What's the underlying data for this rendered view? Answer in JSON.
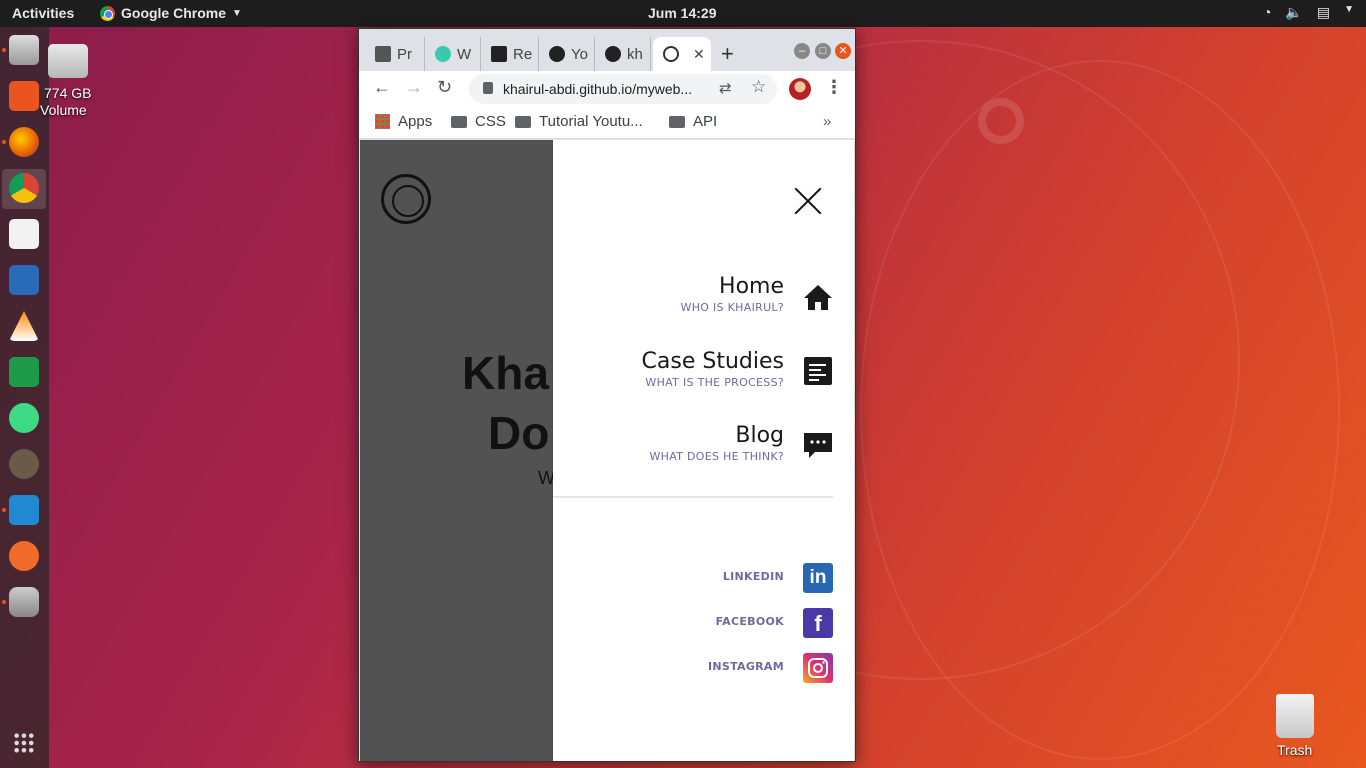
{
  "topbar": {
    "activities": "Activities",
    "app_name": "Google Chrome",
    "clock": "Jum 14:29"
  },
  "desktop": {
    "drive_label_1": "774 GB",
    "drive_label_2": "Volume",
    "trash_label": "Trash"
  },
  "browser": {
    "tabs": [
      {
        "label": "Pr"
      },
      {
        "label": "W"
      },
      {
        "label": "Re"
      },
      {
        "label": "Yo"
      },
      {
        "label": "kh"
      }
    ],
    "url": "khairul-abdi.github.io/myweb...",
    "bookmarks": {
      "apps": "Apps",
      "css": "CSS",
      "tutorial": "Tutorial Youtu...",
      "api": "API"
    }
  },
  "site": {
    "hero_line1": "Kha",
    "hero_line2": "Do",
    "hero_line3": "W",
    "menu": [
      {
        "title": "Home",
        "sub": "WHO IS KHAIRUL?"
      },
      {
        "title": "Case Studies",
        "sub": "WHAT IS THE PROCESS?"
      },
      {
        "title": "Blog",
        "sub": "WHAT DOES HE THINK?"
      }
    ],
    "social": [
      {
        "label": "LINKEDIN",
        "color": "#2867b2"
      },
      {
        "label": "FACEBOOK",
        "color": "#4a3aa8"
      },
      {
        "label": "INSTAGRAM",
        "color": "#c13584"
      }
    ]
  },
  "colors": {
    "ubuntu_orange": "#e95420",
    "menu_subtitle": "#6e6aa0"
  }
}
